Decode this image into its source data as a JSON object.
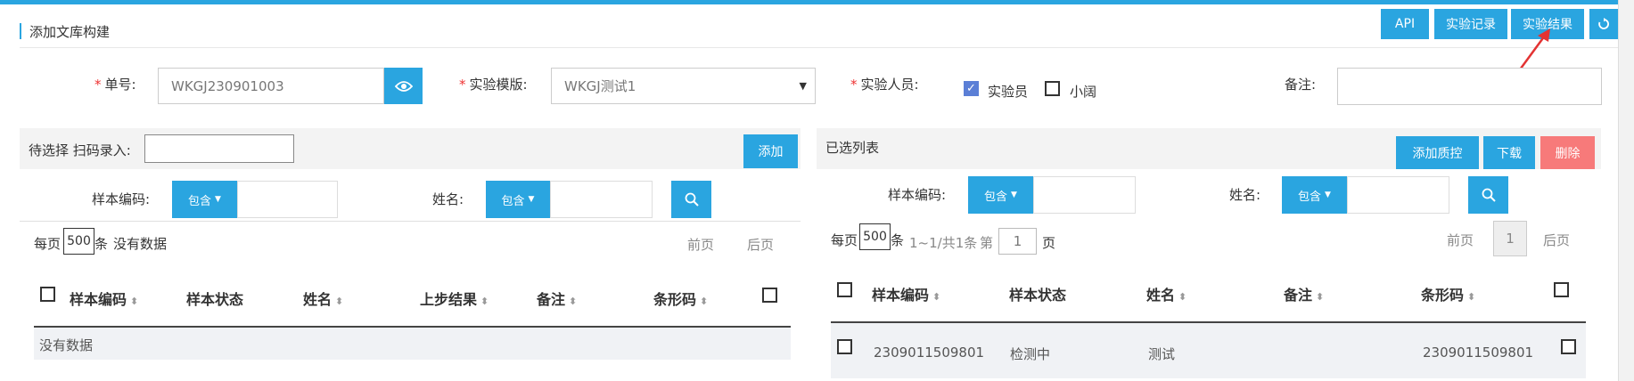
{
  "header": {
    "title": "添加文库构建",
    "buttons": {
      "api": "API",
      "records": "实验记录",
      "results": "实验结果",
      "refresh_icon": "refresh-icon"
    }
  },
  "form": {
    "order_label": "单号:",
    "order_value": "WKGJ230901003",
    "template_label": "实验模版:",
    "template_value": "WKGJ测试1",
    "staff_label": "实验人员:",
    "staff": [
      {
        "name": "实验员",
        "checked": true
      },
      {
        "name": "小阔",
        "checked": false
      }
    ],
    "remark_label": "备注:",
    "remark_value": ""
  },
  "left": {
    "head_label": "待选择 扫码录入:",
    "scan_value": "",
    "add_label": "添加",
    "filter": {
      "code_label": "样本编码:",
      "name_label": "姓名:",
      "contains": "包含"
    },
    "pager": {
      "per_page_prefix": "每页",
      "per_page": "500",
      "per_page_suffix": "条",
      "status": "没有数据",
      "prev": "前页",
      "next": "后页"
    },
    "columns": [
      "样本编码",
      "样本状态",
      "姓名",
      "上步结果",
      "备注",
      "条形码"
    ],
    "empty_text": "没有数据"
  },
  "right": {
    "head_label": "已选列表",
    "buttons": {
      "qc": "添加质控",
      "download": "下载",
      "delete": "删除"
    },
    "filter": {
      "code_label": "样本编码:",
      "name_label": "姓名:",
      "contains": "包含"
    },
    "pager": {
      "per_page_prefix": "每页",
      "per_page": "500",
      "per_page_suffix": "条",
      "summary": "1~1/共1条",
      "page_prefix": "第",
      "page_value": "1",
      "page_suffix": "页",
      "prev": "前页",
      "current": "1",
      "next": "后页"
    },
    "columns": [
      "样本编码",
      "样本状态",
      "姓名",
      "备注",
      "条形码"
    ],
    "rows": [
      {
        "code": "2309011509801",
        "status": "检测中",
        "name": "测试",
        "remark": "",
        "barcode": "2309011509801"
      }
    ]
  },
  "colors": {
    "accent": "#2aa5e0",
    "danger": "#f77a7a",
    "arrow": "#e33333"
  }
}
